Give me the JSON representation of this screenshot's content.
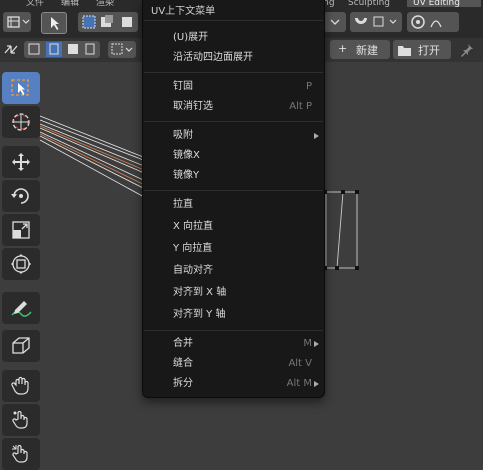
{
  "header": {
    "tabs_top": [
      "文件",
      "编辑",
      "渲染"
    ],
    "workspace_tabs": [
      "Shading",
      "Sculpting",
      "UV Editing"
    ],
    "active_workspace": "UV Editing",
    "new_label": "新建",
    "open_label": "打开"
  },
  "menu": {
    "title": "UV上下文菜单",
    "groups": [
      [
        {
          "label": "(U)展开",
          "shortcut": ""
        },
        {
          "label": "沿活动四边面展开",
          "shortcut": ""
        }
      ],
      [
        {
          "label": "钉固",
          "shortcut": "P"
        },
        {
          "label": "取消钉选",
          "shortcut": "Alt P"
        }
      ],
      [
        {
          "label": "吸附",
          "shortcut": "",
          "submenu": true
        },
        {
          "label": "镜像X",
          "shortcut": ""
        },
        {
          "label": "镜像Y",
          "shortcut": ""
        }
      ],
      [
        {
          "label": "拉直",
          "shortcut": ""
        },
        {
          "label": "X 向拉直",
          "shortcut": ""
        },
        {
          "label": "Y 向拉直",
          "shortcut": ""
        },
        {
          "label": "自动对齐",
          "shortcut": ""
        },
        {
          "label": "对齐到 X 轴",
          "shortcut": ""
        },
        {
          "label": "对齐到 Y 轴",
          "shortcut": ""
        }
      ],
      [
        {
          "label": "合并",
          "shortcut": "M",
          "submenu": true
        },
        {
          "label": "缝合",
          "shortcut": "Alt V"
        },
        {
          "label": "拆分",
          "shortcut": "Alt M",
          "submenu": true
        }
      ]
    ]
  },
  "colors": {
    "accent": "#4772b3",
    "menu_bg": "#181818",
    "viewport_bg": "#3d3d3d"
  }
}
